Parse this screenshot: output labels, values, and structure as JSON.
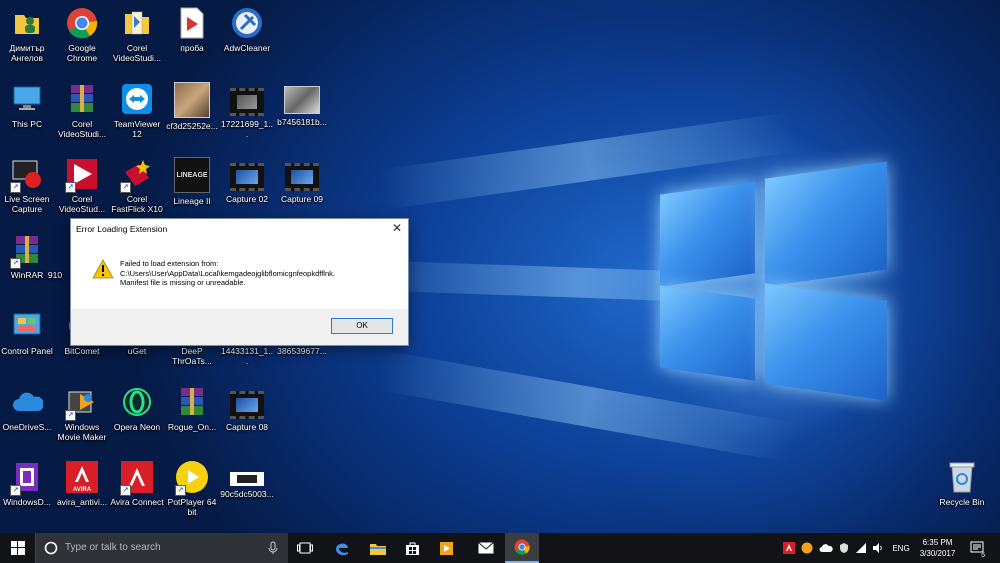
{
  "desktop_icons": [
    {
      "label": "Димитър Ангелов",
      "icon": "user-folder-icon"
    },
    {
      "label": "Google Chrome",
      "icon": "chrome-icon"
    },
    {
      "label": "Corel VideoStudi...",
      "icon": "corel-folder-icon"
    },
    {
      "label": "проба",
      "icon": "pdf-file-icon"
    },
    {
      "label": "AdwCleaner",
      "icon": "adwcleaner-icon"
    },
    {
      "label": "This PC",
      "icon": "computer-icon"
    },
    {
      "label": "Corel VideoStudi...",
      "icon": "winrar-archive-icon"
    },
    {
      "label": "TeamViewer 12",
      "icon": "teamviewer-icon"
    },
    {
      "label": "cf3d25252e...",
      "icon": "image-thumbnail-icon"
    },
    {
      "label": "17221699_1...",
      "icon": "video-thumbnail-icon"
    },
    {
      "label": "b7456181b...",
      "icon": "image-thumbnail-icon"
    },
    {
      "label": "Live Screen Capture",
      "icon": "screen-capture-icon"
    },
    {
      "label": "Corel VideoStud...",
      "icon": "corel-app-icon"
    },
    {
      "label": "Corel FastFlick X10",
      "icon": "fastflick-icon"
    },
    {
      "label": "Lineage II",
      "icon": "lineage-icon"
    },
    {
      "label": "Capture 02",
      "icon": "video-thumbnail-icon"
    },
    {
      "label": "Capture 09",
      "icon": "video-thumbnail-icon"
    },
    {
      "label": "WinRAR",
      "icon": "winrar-icon"
    },
    {
      "label": "910",
      "icon": "file-icon"
    },
    {
      "label": "Control Panel",
      "icon": "control-panel-icon"
    },
    {
      "label": "BitComet",
      "icon": "bitcomet-icon"
    },
    {
      "label": "uGet",
      "icon": "uget-icon"
    },
    {
      "label": "DeeP ThrOaTs...",
      "icon": "image-thumbnail-icon"
    },
    {
      "label": "14433131_1...",
      "icon": "image-thumbnail-icon"
    },
    {
      "label": "386539677...",
      "icon": "image-thumbnail-icon"
    },
    {
      "label": "OneDriveS...",
      "icon": "onedrive-icon"
    },
    {
      "label": "Windows Movie Maker",
      "icon": "movie-maker-icon"
    },
    {
      "label": "Opera Neon",
      "icon": "opera-neon-icon"
    },
    {
      "label": "Rogue_On...",
      "icon": "winrar-archive-icon"
    },
    {
      "label": "Capture 08",
      "icon": "video-thumbnail-icon"
    },
    {
      "label": "WindowsD...",
      "icon": "windows-defender-icon"
    },
    {
      "label": "avira_antivi...",
      "icon": "avira-icon"
    },
    {
      "label": "Avira Connect",
      "icon": "avira-connect-icon"
    },
    {
      "label": "PotPlayer 64 bit",
      "icon": "potplayer-icon"
    },
    {
      "label": "90c5dc5003...",
      "icon": "image-thumbnail-icon"
    },
    {
      "label": "Recycle Bin",
      "icon": "recycle-bin-icon"
    }
  ],
  "dialog": {
    "title": "Error Loading Extension",
    "line1": "Failed to load extension from:",
    "line2": "C:\\Users\\User\\AppData\\Local\\kemgadeojglibflomicgnfeopkdfflnk.",
    "line3": "Manifest file is missing or unreadable.",
    "ok_label": "OK",
    "close_glyph": "✕"
  },
  "taskbar": {
    "search_placeholder": "Type or talk to search",
    "language": "ENG",
    "time": "6:35 PM",
    "date": "3/30/2017",
    "notification_count": "5"
  },
  "colors": {
    "taskbar": "#121316",
    "dialog_button_border": "#2a7ad5",
    "warning_yellow": "#f5c400"
  }
}
